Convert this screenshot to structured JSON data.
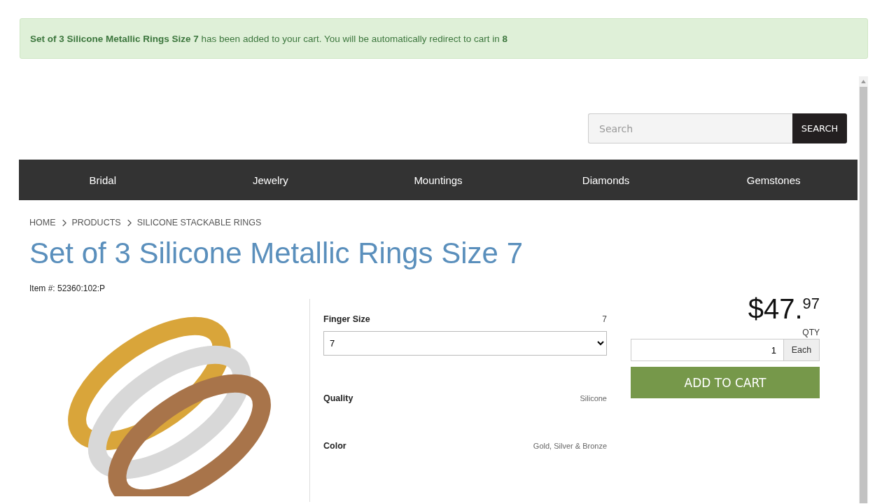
{
  "alert": {
    "product": "Set of 3 Silicone Metallic Rings Size 7",
    "message": "has been added to your cart. You will be automatically redirect to cart in",
    "countdown": "8"
  },
  "search": {
    "placeholder": "Search",
    "button": "SEARCH"
  },
  "nav": [
    "Bridal",
    "Jewelry",
    "Mountings",
    "Diamonds",
    "Gemstones"
  ],
  "breadcrumb": [
    "HOME",
    "PRODUCTS",
    "SILICONE STACKABLE RINGS"
  ],
  "title": "Set of 3 Silicone Metallic Rings Size 7",
  "item_number": "Item #: 52360:102:P",
  "attributes": [
    {
      "kind": "select",
      "label": "Finger Size",
      "value": "7",
      "selection": "7"
    },
    {
      "kind": "text",
      "label": "Quality",
      "value": "Silicone"
    },
    {
      "kind": "text",
      "label": "Color",
      "value": "Gold, Silver & Bronze"
    }
  ],
  "price": {
    "whole": "$47.",
    "cents": "97"
  },
  "qty": {
    "label": "QTY",
    "value": "1",
    "unit": "Each"
  },
  "add_to_cart": "ADD TO CART"
}
